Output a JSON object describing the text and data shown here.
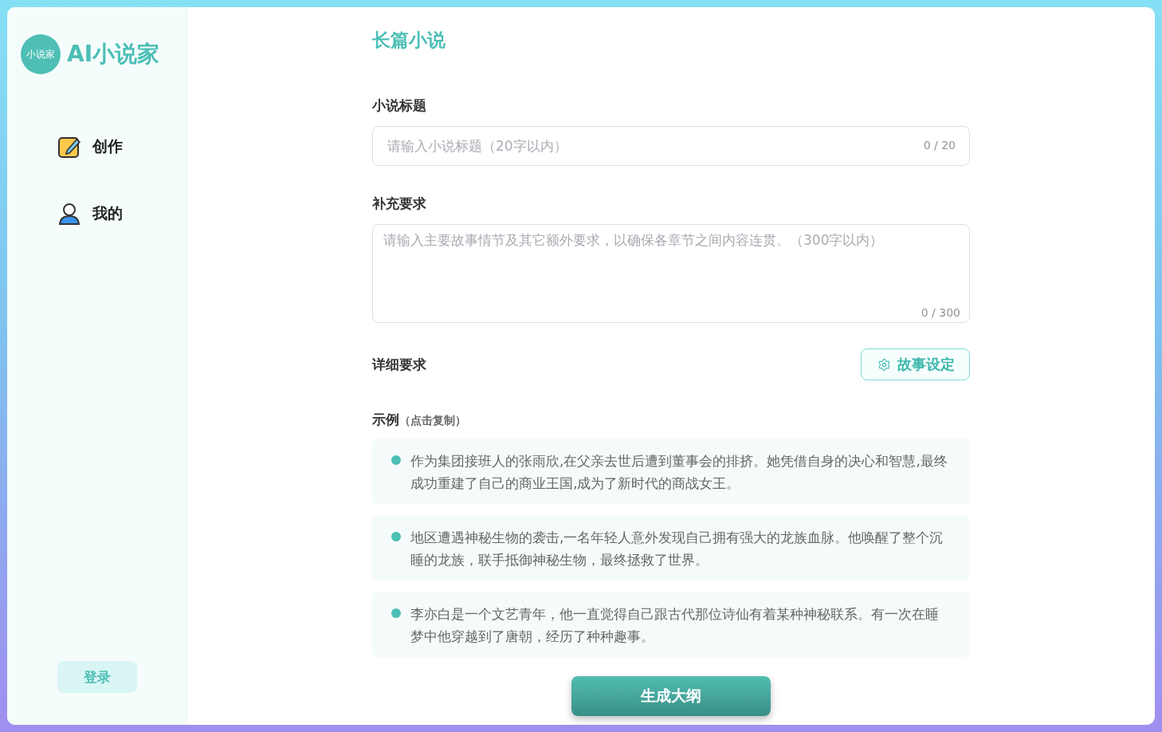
{
  "sidebar": {
    "logo_badge": "小说家",
    "logo_text": "AI小说家",
    "items": [
      {
        "kind": "create",
        "label": "创作"
      },
      {
        "kind": "profile",
        "label": "我的"
      }
    ],
    "login_button": "登录"
  },
  "main": {
    "heading": "长篇小说",
    "title_field": {
      "label": "小说标题",
      "placeholder": "请输入小说标题（20字以内）",
      "counter": "0 / 20"
    },
    "extra_field": {
      "label": "补充要求",
      "placeholder": "请输入主要故事情节及其它额外要求，以确保各章节之间内容连贯。（300字以内）",
      "counter": "0 / 300"
    },
    "details": {
      "label": "详细要求",
      "button": "故事设定"
    },
    "examples": {
      "label": "示例",
      "hint": "（点击复制）",
      "items": [
        "作为集团接班人的张雨欣,在父亲去世后遭到董事会的排挤。她凭借自身的决心和智慧,最终成功重建了自己的商业王国,成为了新时代的商战女王。",
        "地区遭遇神秘生物的袭击,一名年轻人意外发现自己拥有强大的龙族血脉。他唤醒了整个沉睡的龙族，联手抵御神秘生物，最终拯救了世界。",
        "李亦白是一个文艺青年，他一直觉得自己跟古代那位诗仙有着某种神秘联系。有一次在睡梦中他穿越到了唐朝，经历了种种趣事。"
      ]
    },
    "generate_button": "生成大纲"
  }
}
